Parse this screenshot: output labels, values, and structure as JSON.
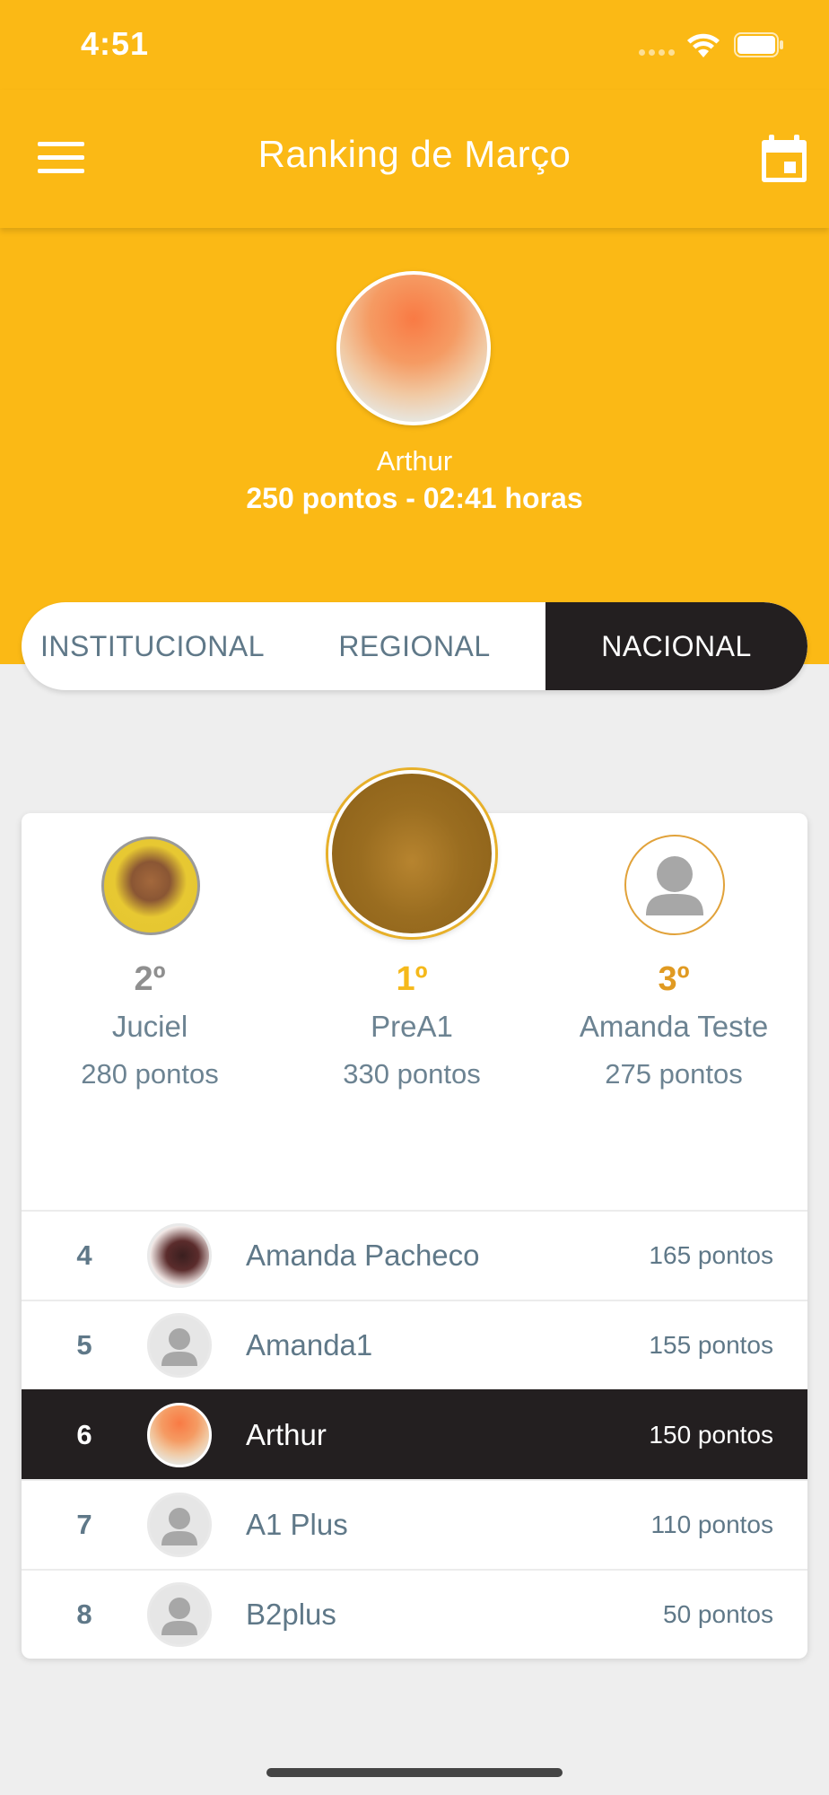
{
  "status_bar": {
    "time": "4:51"
  },
  "app_bar": {
    "title": "Ranking de Março",
    "menu_icon": "menu-icon",
    "calendar_icon": "calendar-icon"
  },
  "current_user": {
    "name": "Arthur",
    "stats": "250 pontos - 02:41 horas"
  },
  "tabs": [
    {
      "label": "INSTITUCIONAL",
      "active": false
    },
    {
      "label": "REGIONAL",
      "active": false
    },
    {
      "label": "NACIONAL",
      "active": true
    }
  ],
  "podium": {
    "first": {
      "rank": "1º",
      "name": "PreA1",
      "points": "330 pontos",
      "color": "#f5b91b"
    },
    "second": {
      "rank": "2º",
      "name": "Juciel",
      "points": "280 pontos",
      "color": "#8f8f8f"
    },
    "third": {
      "rank": "3º",
      "name": "Amanda Teste",
      "points": "275 pontos",
      "color": "#e09a22"
    }
  },
  "ranking": [
    {
      "rank": "4",
      "name": "Amanda Pacheco",
      "points": "165 pontos",
      "avatar": "photo"
    },
    {
      "rank": "5",
      "name": "Amanda1",
      "points": "155 pontos",
      "avatar": "placeholder"
    },
    {
      "rank": "6",
      "name": "Arthur",
      "points": "150 pontos",
      "avatar": "photo",
      "is_current_user": true
    },
    {
      "rank": "7",
      "name": "A1 Plus",
      "points": "110 pontos",
      "avatar": "placeholder"
    },
    {
      "rank": "8",
      "name": "B2plus",
      "points": "50 pontos",
      "avatar": "placeholder"
    }
  ],
  "colors": {
    "brand": "#fbb915",
    "dark": "#231f20",
    "text": "#5f7888",
    "background": "#eeeeee"
  }
}
